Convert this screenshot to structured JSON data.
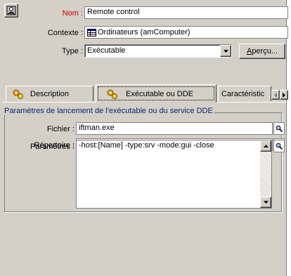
{
  "header": {
    "nom_label": "Nom :",
    "nom_value": "Remote control",
    "contexte_label": "Contexte :",
    "contexte_value": "Ordinateurs (amComputer)",
    "type_label": "Type :",
    "type_value": "Exécutable",
    "apercu_label": "Aperçu..."
  },
  "tabs": [
    {
      "label": "Description",
      "icon": "gears-icon"
    },
    {
      "label": "Exécutable ou DDE",
      "icon": "gears-icon"
    },
    {
      "label": "Caractéristic",
      "icon": ""
    }
  ],
  "group": {
    "title": "Paramètres de lancement de l'exécutable ou du service DDE",
    "fichier_label": "Fichier :",
    "fichier_value": "iftman.exe",
    "repertoire_label": "Répertoire :",
    "repertoire_value": "",
    "parametres_label": "Paramètres :",
    "parametres_value": "-host:[Name] -type:srv -mode:gui -close"
  },
  "colors": {
    "nom_label": "#cc0000",
    "group_title": "#0a246a",
    "chrome": "#d4d0c8"
  }
}
